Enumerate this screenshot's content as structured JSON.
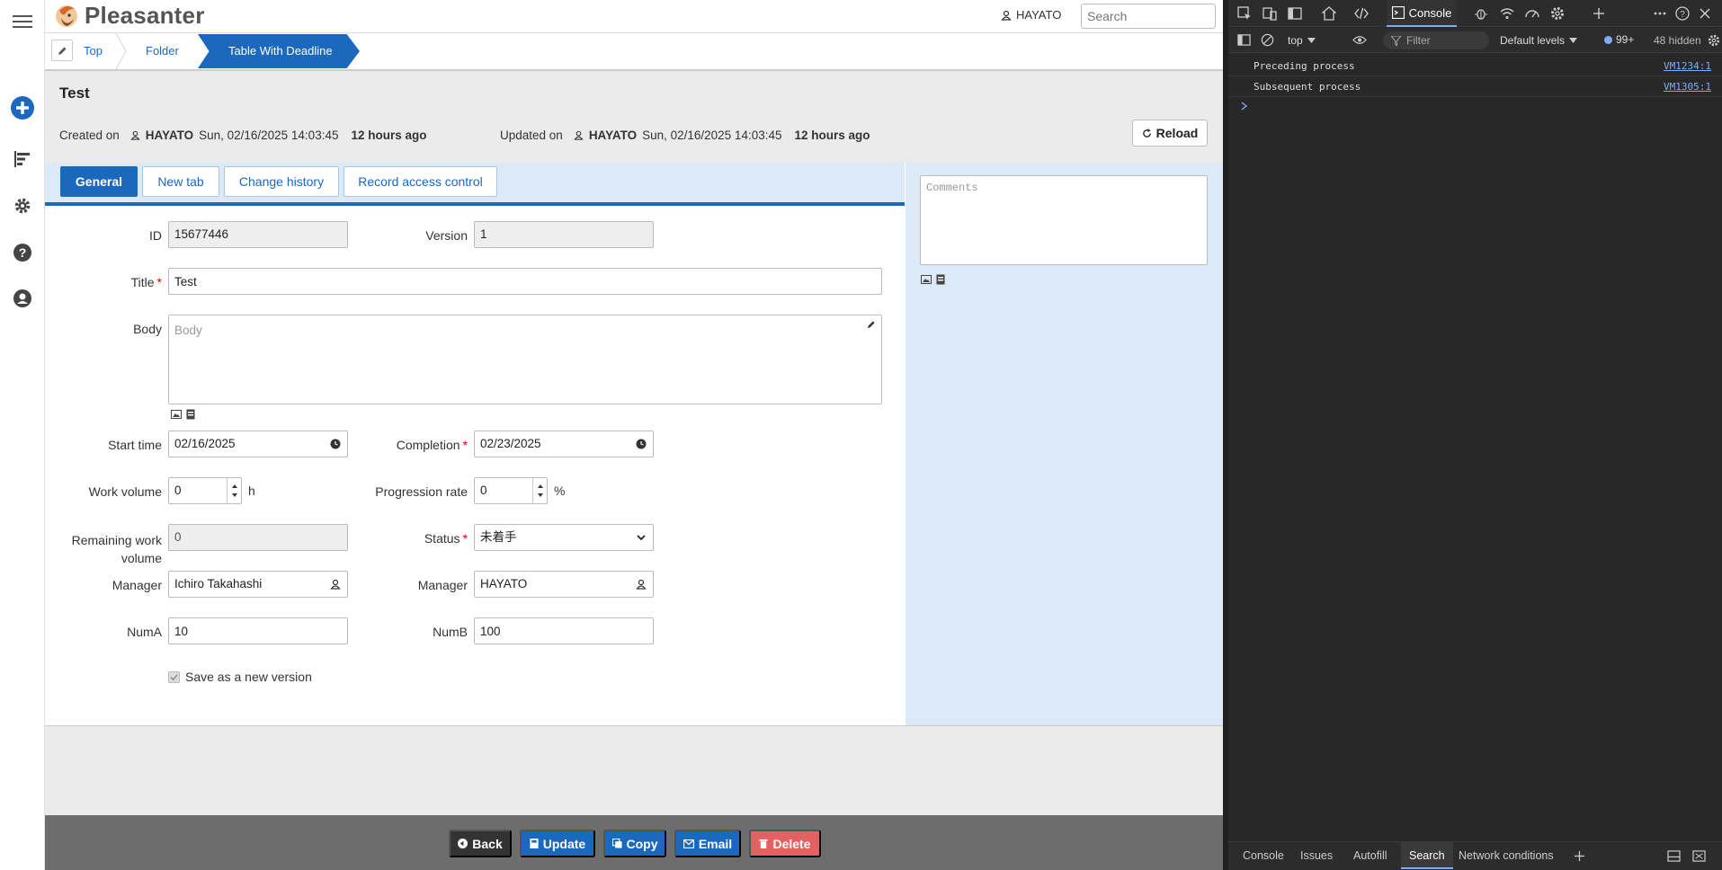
{
  "app": {
    "name": "Pleasanter",
    "user": "HAYATO",
    "search_placeholder": "Search"
  },
  "breadcrumb": {
    "items": [
      "Top",
      "Folder",
      "Table With Deadline"
    ]
  },
  "record": {
    "title": "Test",
    "created_label": "Created on",
    "created_by": "HAYATO",
    "created_at": "Sun, 02/16/2025 14:03:45",
    "created_rel": "12 hours ago",
    "updated_label": "Updated on",
    "updated_by": "HAYATO",
    "updated_at": "Sun, 02/16/2025 14:03:45",
    "updated_rel": "12 hours ago",
    "reload_label": "Reload"
  },
  "tabs": [
    "General",
    "New tab",
    "Change history",
    "Record access control"
  ],
  "form": {
    "id_label": "ID",
    "id_value": "15677446",
    "version_label": "Version",
    "version_value": "1",
    "title_label": "Title",
    "title_value": "Test",
    "body_label": "Body",
    "body_placeholder": "Body",
    "start_label": "Start time",
    "start_value": "02/16/2025",
    "completion_label": "Completion",
    "completion_value": "02/23/2025",
    "work_label": "Work volume",
    "work_value": "0",
    "work_unit": "h",
    "progress_label": "Progression rate",
    "progress_value": "0",
    "progress_unit": "%",
    "remaining_label_1": "Remaining work",
    "remaining_label_2": "volume",
    "remaining_value": "0",
    "status_label": "Status",
    "status_value": "未着手",
    "manager_label": "Manager",
    "manager_value": "Ichiro Takahashi",
    "owner_label": "Manager",
    "owner_value": "HAYATO",
    "numa_label": "NumA",
    "numa_value": "10",
    "numb_label": "NumB",
    "numb_value": "100",
    "save_version_label": "Save as a new version"
  },
  "comments": {
    "placeholder": "Comments"
  },
  "footer": {
    "back": "Back",
    "update": "Update",
    "copy": "Copy",
    "email": "Email",
    "delete": "Delete"
  },
  "devtools": {
    "console_tab": "Console",
    "context": "top",
    "filter_placeholder": "Filter",
    "levels": "Default levels",
    "badge": "99+",
    "hidden": "48 hidden",
    "logs": [
      {
        "message": "Preceding process",
        "source": "VM1234:1"
      },
      {
        "message": "Subsequent process",
        "source": "VM1305:1"
      }
    ],
    "drawer_tabs": [
      "Console",
      "Issues",
      "Autofill",
      "Search",
      "Network conditions"
    ]
  },
  "colors": {
    "primary": "#1b68bf",
    "danger": "#e46161",
    "dark_button": "#333333",
    "panel_blue": "#dce9f6"
  }
}
